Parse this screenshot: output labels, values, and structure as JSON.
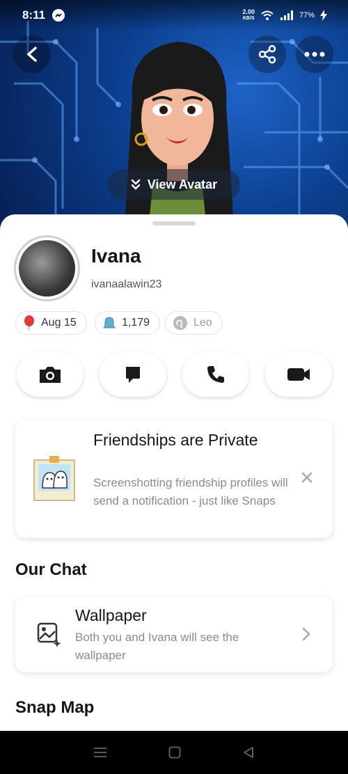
{
  "status_bar": {
    "time": "8:11",
    "network_speed_value": "2.00",
    "network_speed_unit": "KB/S",
    "battery": "77%"
  },
  "hero": {
    "view_avatar_label": "View Avatar"
  },
  "profile": {
    "name": "Ivana",
    "username": "ivanaalawin23",
    "birthday": "Aug 15",
    "snapscore": "1,179",
    "zodiac": "Leo"
  },
  "friendship_card": {
    "title": "Friendships are Private",
    "subtitle": "Screenshotting friendship profiles will send a notification - just like Snaps"
  },
  "our_chat": {
    "section_title": "Our Chat",
    "wallpaper_title": "Wallpaper",
    "wallpaper_subtitle": "Both you and Ivana will see the wallpaper"
  },
  "snap_map": {
    "section_title": "Snap Map"
  },
  "colors": {
    "hero_blue": "#0c3f8f",
    "text_primary": "#161616",
    "text_secondary": "#8a8a8a"
  }
}
